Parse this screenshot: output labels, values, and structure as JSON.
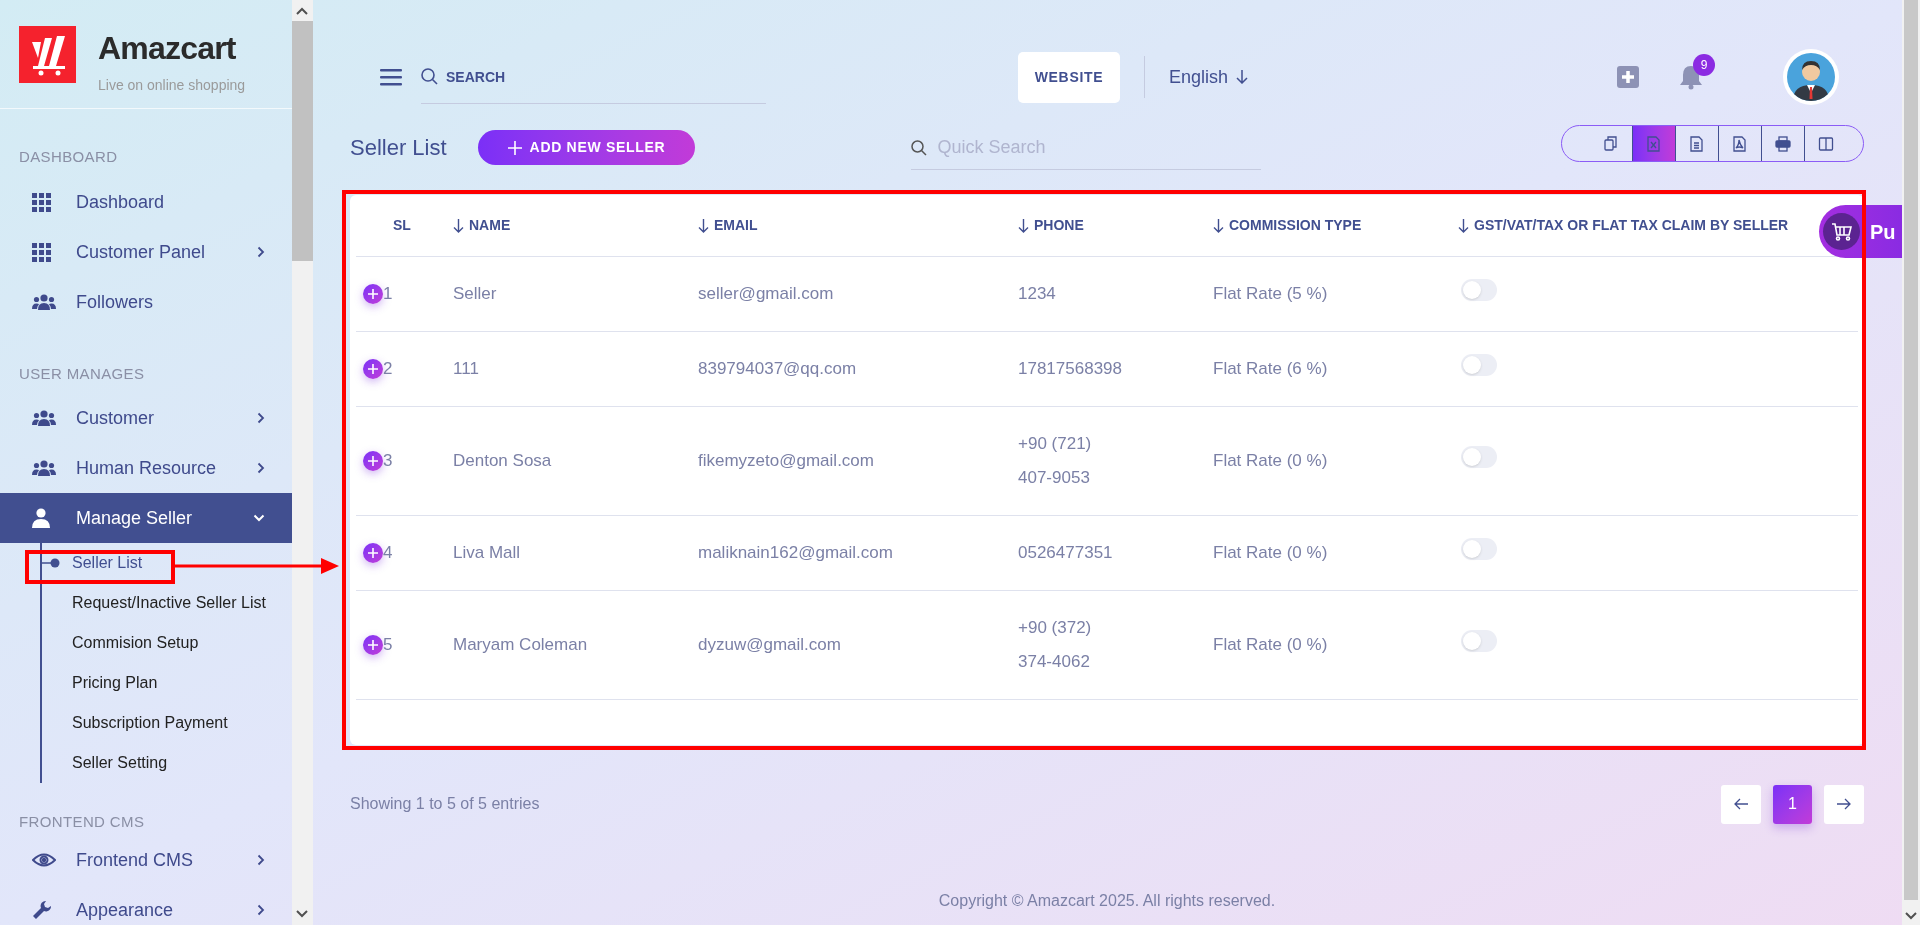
{
  "brand": {
    "name": "Amazcart",
    "tagline": "Live on online shopping"
  },
  "sidebar": {
    "sections": [
      {
        "title": "DASHBOARD",
        "items": [
          {
            "label": "Dashboard",
            "selected": false
          },
          {
            "label": "Customer Panel",
            "selected": false,
            "expanded": false
          },
          {
            "label": "Followers",
            "selected": false
          }
        ]
      },
      {
        "title": "USER MANAGES",
        "items": [
          {
            "label": "Customer",
            "selected": false,
            "expanded": false
          },
          {
            "label": "Human Resource",
            "selected": false,
            "expanded": false
          },
          {
            "label": "Manage Seller",
            "selected": true,
            "expanded": true,
            "children": [
              {
                "label": "Seller List",
                "selected": true
              },
              {
                "label": "Request/Inactive Seller List",
                "selected": false
              },
              {
                "label": "Commision Setup",
                "selected": false
              },
              {
                "label": "Pricing Plan",
                "selected": false
              },
              {
                "label": "Subscription Payment",
                "selected": false
              },
              {
                "label": "Seller Setting",
                "selected": false
              }
            ]
          }
        ]
      },
      {
        "title": "FRONTEND CMS",
        "items": [
          {
            "label": "Frontend CMS",
            "selected": false,
            "expanded": false
          },
          {
            "label": "Appearance",
            "selected": false,
            "expanded": false
          }
        ]
      }
    ]
  },
  "header": {
    "search": {
      "placeholder": "SEARCH"
    },
    "website_button": "WEBSITE",
    "language": "English",
    "notification_count": "9"
  },
  "page": {
    "title": "Seller List",
    "add_button": "ADD NEW SELLER",
    "quick_search": {
      "placeholder": "Quick Search"
    },
    "export_buttons": [
      {
        "selected": false
      },
      {
        "selected": true
      },
      {
        "selected": false
      },
      {
        "selected": false
      },
      {
        "selected": false
      },
      {
        "selected": false
      }
    ]
  },
  "table": {
    "columns": [
      {
        "label": "SL",
        "sortable": false
      },
      {
        "label": "NAME",
        "sortable": true
      },
      {
        "label": "EMAIL",
        "sortable": true
      },
      {
        "label": "PHONE",
        "sortable": true
      },
      {
        "label": "COMMISSION TYPE",
        "sortable": true
      },
      {
        "label": "GST/VAT/TAX OR FLAT TAX CLAIM BY SELLER",
        "sortable": true
      }
    ],
    "rows": [
      {
        "sl": "1",
        "name": "Seller",
        "email": "seller@gmail.com",
        "phone": "1234",
        "commission_type": "Flat Rate (5 %)",
        "tax_claim": false
      },
      {
        "sl": "2",
        "name": "111",
        "email": "839794037@qq.com",
        "phone": "17817568398",
        "commission_type": "Flat Rate (6 %)",
        "tax_claim": false
      },
      {
        "sl": "3",
        "name": "Denton Sosa",
        "email": "fikemyzeto@gmail.com",
        "phone": "+90 (721) 407-9053",
        "commission_type": "Flat Rate (0 %)",
        "tax_claim": false
      },
      {
        "sl": "4",
        "name": "Liva Mall",
        "email": "maliknain162@gmail.com",
        "phone": "0526477351",
        "commission_type": "Flat Rate (0 %)",
        "tax_claim": false
      },
      {
        "sl": "5",
        "name": "Maryam Coleman",
        "email": "dyzuw@gmail.com",
        "phone": "+90 (372) 374-4062",
        "commission_type": "Flat Rate (0 %)",
        "tax_claim": false
      }
    ]
  },
  "floating_button": {
    "label": "Pu"
  },
  "footer": {
    "entries_info": "Showing 1 to 5 of 5 entries",
    "pages": [
      {
        "label": "1",
        "selected": true
      }
    ],
    "copyright": "Copyright © Amazcart 2025. All rights reserved."
  }
}
